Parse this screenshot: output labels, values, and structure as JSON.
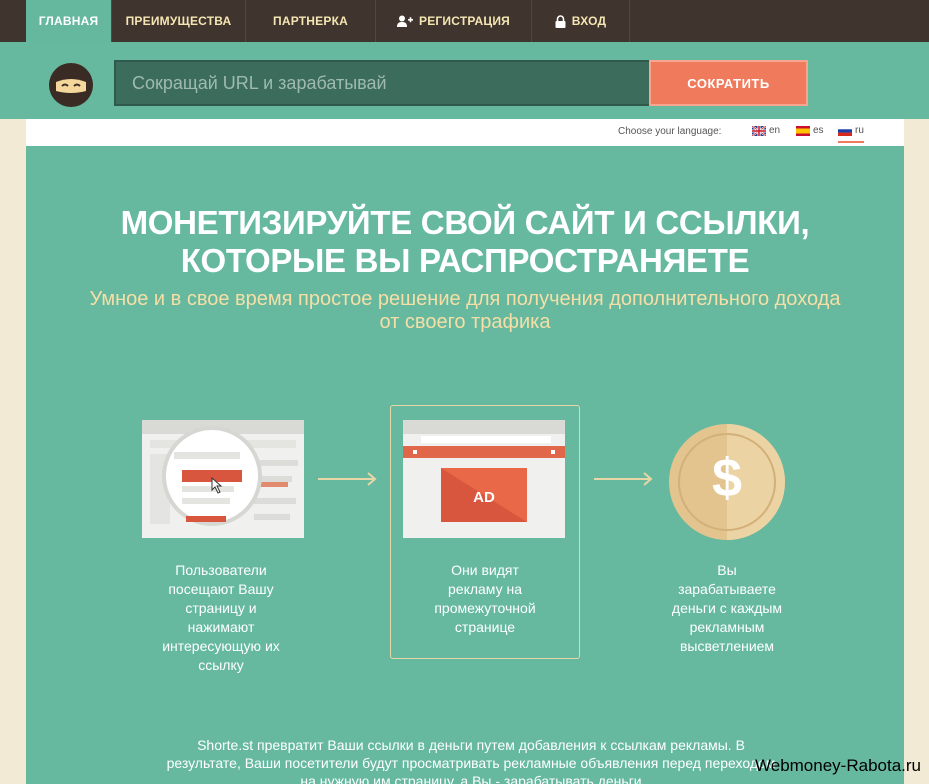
{
  "nav": {
    "home": "ГЛАВНАЯ",
    "advantages": "ПРЕИМУЩЕСТВА",
    "partnership": "ПАРТНЕРКА",
    "register": "РЕГИСТРАЦИЯ",
    "login": "ВХОД"
  },
  "search": {
    "placeholder": "Сокращай URL и зарабатывай",
    "value": "",
    "button_label": "СОКРАТИТЬ"
  },
  "language": {
    "label": "Choose your language:",
    "options": [
      {
        "code": "en",
        "flag": "uk-flag-icon",
        "active": false
      },
      {
        "code": "es",
        "flag": "spain-flag-icon",
        "active": false
      },
      {
        "code": "ru",
        "flag": "russia-flag-icon",
        "active": true
      }
    ]
  },
  "hero": {
    "headline_line1": "МОНЕТИЗИРУЙТЕ СВОЙ САЙТ И ССЫЛКИ,",
    "headline_line2": "КОТОРЫЕ ВЫ РАСПРОСТРАНЯЕТЕ",
    "subline_line1": "Умное и в свое время простое решение для получения дополнительного дохода",
    "subline_line2": "от своего трафика"
  },
  "steps": [
    {
      "icon": "magnified-page-icon",
      "lines": [
        "Пользователи",
        "посещают Вашу",
        "страницу и",
        "нажимают",
        "интересующую их",
        "ссылку"
      ]
    },
    {
      "icon": "ad-page-icon",
      "ad_label": "AD",
      "lines": [
        "Они видят",
        "рекламу на",
        "промежуточной",
        "странице"
      ]
    },
    {
      "icon": "dollar-coin-icon",
      "coin_symbol": "$",
      "lines": [
        "Вы",
        "зарабатываете",
        "деньги с каждым",
        "рекламным",
        "высветлением"
      ]
    }
  ],
  "bottom": {
    "line1": "Shorte.st превратит Ваши ссылки в деньги путем добавления к ссылкам рекламы. В",
    "line2": "результате, Ваши посетители будут просматривать рекламные объявления перед переходом",
    "line3": "на нужную им страницу, а Вы - зарабатывать деньги"
  },
  "watermark": "Webmoney-Rabota.ru",
  "colors": {
    "nav_bg": "#3f342e",
    "accent_green": "#66b99f",
    "accent_orange": "#ef7b5c",
    "nav_text": "#f6e6b3",
    "subline": "#f6dfa6",
    "page_bg": "#f3ead6"
  }
}
